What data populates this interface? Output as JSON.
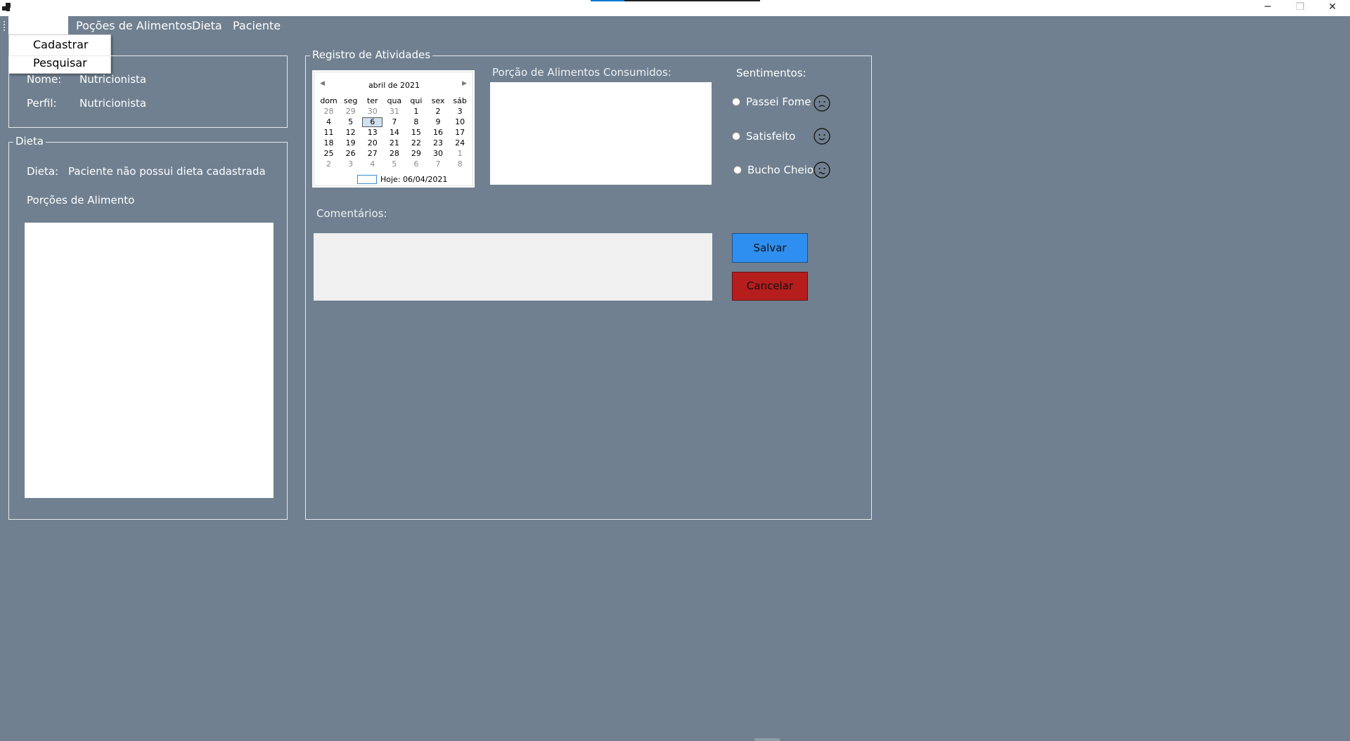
{
  "window": {
    "controls": {
      "minimize": "─",
      "restore": "❐",
      "close": "✕"
    }
  },
  "menu": {
    "items": [
      "",
      "Poções de Alimentos",
      "Dieta",
      "Paciente"
    ],
    "dropdown": [
      "Cadastrar",
      "Pesquisar"
    ]
  },
  "profile": {
    "nome_label": "Nome:",
    "nome_value": "Nutricionista",
    "perfil_label": "Perfil:",
    "perfil_value": "Nutricionista"
  },
  "dieta": {
    "caption": "Dieta",
    "dieta_label": "Dieta:",
    "dieta_value": "Paciente não possui dieta cadastrada",
    "porcoes_label": "Porções de Alimento"
  },
  "registro": {
    "caption": "Registro de Atividades",
    "porcao_label": "Porção de Alimentos Consumidos:",
    "comentarios_label": "Comentários:",
    "sentimentos_label": "Sentimentos:",
    "sentimentos": [
      {
        "label": "Passei Fome",
        "icon": "sad-face-icon"
      },
      {
        "label": "Satisfeito",
        "icon": "happy-face-icon"
      },
      {
        "label": "Bucho Cheio",
        "icon": "sick-face-icon"
      }
    ],
    "save_label": "Salvar",
    "cancel_label": "Cancelar"
  },
  "calendar": {
    "month_title": "abril de 2021",
    "weekdays": [
      "dom",
      "seg",
      "ter",
      "qua",
      "qui",
      "sex",
      "sáb"
    ],
    "weeks": [
      [
        "28",
        "29",
        "30",
        "31",
        "1",
        "2",
        "3"
      ],
      [
        "4",
        "5",
        "6",
        "7",
        "8",
        "9",
        "10"
      ],
      [
        "11",
        "12",
        "13",
        "14",
        "15",
        "16",
        "17"
      ],
      [
        "18",
        "19",
        "20",
        "21",
        "22",
        "23",
        "24"
      ],
      [
        "25",
        "26",
        "27",
        "28",
        "29",
        "30",
        "1"
      ],
      [
        "2",
        "3",
        "4",
        "5",
        "6",
        "7",
        "8"
      ]
    ],
    "other_month": [
      [
        0,
        0
      ],
      [
        0,
        1
      ],
      [
        0,
        2
      ],
      [
        0,
        3
      ],
      [
        4,
        6
      ],
      [
        5,
        0
      ],
      [
        5,
        1
      ],
      [
        5,
        2
      ],
      [
        5,
        3
      ],
      [
        5,
        4
      ],
      [
        5,
        5
      ],
      [
        5,
        6
      ]
    ],
    "selected": [
      1,
      2
    ],
    "today_label": "Hoje: 06/04/2021"
  },
  "colors": {
    "background": "#708090",
    "save_button": "#2f8ff0",
    "cancel_button": "#b61d1d"
  }
}
